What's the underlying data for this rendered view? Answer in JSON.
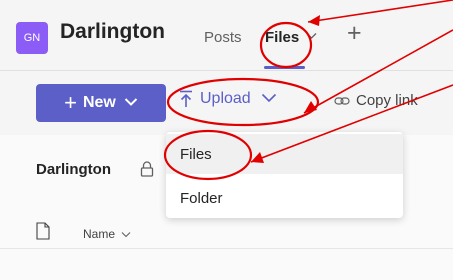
{
  "header": {
    "avatar_initials": "GN",
    "team_name": "Darlington",
    "tabs": [
      {
        "label": "Posts"
      },
      {
        "label": "Files"
      }
    ],
    "add_tab": "+"
  },
  "toolbar": {
    "new_label": "New",
    "upload_label": "Upload",
    "copy_link_label": "Copy link"
  },
  "upload_menu": {
    "items": [
      {
        "label": "Files"
      },
      {
        "label": "Folder"
      }
    ]
  },
  "content": {
    "breadcrumb": "Darlington",
    "columns": [
      {
        "label": "Name"
      }
    ]
  },
  "colors": {
    "accent": "#5b5fc7",
    "avatar": "#8b5cf6",
    "annotation": "#e00000"
  },
  "icons": [
    "plus-icon",
    "chevron-down-icon",
    "upload-icon",
    "link-icon",
    "lock-icon",
    "document-icon"
  ]
}
